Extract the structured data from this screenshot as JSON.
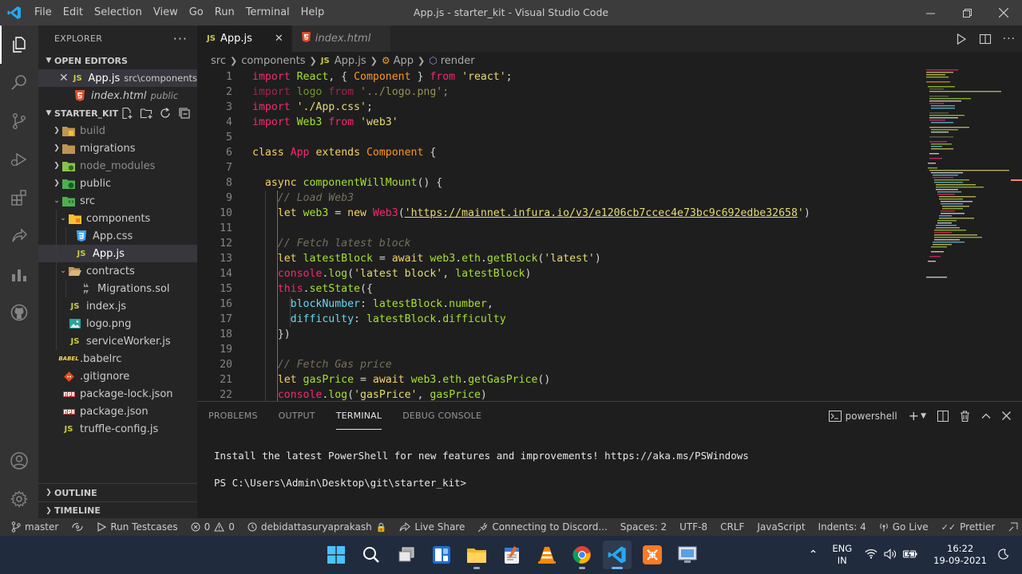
{
  "window": {
    "title": "App.js - starter_kit - Visual Studio Code",
    "menu": [
      "File",
      "Edit",
      "Selection",
      "View",
      "Go",
      "Run",
      "Terminal",
      "Help"
    ]
  },
  "sidebar": {
    "header": "EXPLORER",
    "open_editors": {
      "title": "OPEN EDITORS",
      "items": [
        {
          "icon": "JS",
          "name": "App.js",
          "desc": "src\\components"
        },
        {
          "icon": "html",
          "name": "index.html",
          "desc": "public"
        }
      ]
    },
    "project": {
      "title": "STARTER_KIT",
      "tree": [
        {
          "name": "build",
          "type": "folder",
          "depth": 0,
          "collapsed": true
        },
        {
          "name": "migrations",
          "type": "folder",
          "depth": 0,
          "collapsed": true
        },
        {
          "name": "node_modules",
          "type": "folder",
          "depth": 0,
          "collapsed": true
        },
        {
          "name": "public",
          "type": "folder",
          "depth": 0,
          "collapsed": true
        },
        {
          "name": "src",
          "type": "folder",
          "depth": 0,
          "collapsed": false
        },
        {
          "name": "components",
          "type": "folder",
          "depth": 1,
          "collapsed": false
        },
        {
          "name": "App.css",
          "type": "css",
          "depth": 2
        },
        {
          "name": "App.js",
          "type": "js",
          "depth": 2
        },
        {
          "name": "contracts",
          "type": "folder",
          "depth": 1,
          "collapsed": false
        },
        {
          "name": "Migrations.sol",
          "type": "sol",
          "depth": 2
        },
        {
          "name": "index.js",
          "type": "js",
          "depth": 1
        },
        {
          "name": "logo.png",
          "type": "png",
          "depth": 1
        },
        {
          "name": "serviceWorker.js",
          "type": "js",
          "depth": 1
        },
        {
          "name": ".babelrc",
          "type": "babel",
          "depth": 0
        },
        {
          "name": ".gitignore",
          "type": "git",
          "depth": 0
        },
        {
          "name": "package-lock.json",
          "type": "npm",
          "depth": 0
        },
        {
          "name": "package.json",
          "type": "npm",
          "depth": 0
        },
        {
          "name": "truffle-config.js",
          "type": "js",
          "depth": 0
        }
      ]
    },
    "outline": "OUTLINE",
    "timeline": "TIMELINE"
  },
  "tabs": [
    {
      "icon": "JS",
      "label": "App.js",
      "active": true
    },
    {
      "icon": "html",
      "label": "index.html",
      "active": false
    }
  ],
  "breadcrumb": [
    "src",
    "components",
    "App.js",
    "App",
    "render"
  ],
  "editor": {
    "line_numbers": [
      "1",
      "2",
      "3",
      "4",
      "5",
      "6",
      "7",
      "8",
      "9",
      "10",
      "11",
      "12",
      "13",
      "14",
      "15",
      "16",
      "17",
      "18",
      "19",
      "20",
      "21",
      "22"
    ]
  },
  "panel": {
    "tabs": [
      "PROBLEMS",
      "OUTPUT",
      "TERMINAL",
      "DEBUG CONSOLE"
    ],
    "active_tab": "TERMINAL",
    "shell": "powershell",
    "terminal_lines": [
      "Install the latest PowerShell for new features and improvements! https://aka.ms/PSWindows",
      "PS C:\\Users\\Admin\\Desktop\\git\\starter_kit>"
    ]
  },
  "statusbar": {
    "branch": "master",
    "run_testcases": "Run Testcases",
    "errors": "0",
    "warnings": "0",
    "account": "debidattasuryaprakash",
    "live_share": "Live Share",
    "discord": "Connecting to Discord...",
    "spaces": "Spaces: 2",
    "encoding": "UTF-8",
    "eol": "CRLF",
    "language": "JavaScript",
    "indents": "Indents: 4",
    "go_live": "Go Live",
    "prettier": "Prettier"
  },
  "taskbar": {
    "lang_top": "ENG",
    "lang_bottom": "IN",
    "time": "16:22",
    "date": "19-09-2021"
  },
  "colors": {
    "accent": "#007acc",
    "activitybar": "#333333",
    "sidebar": "#252526",
    "editor": "#1e1e1e",
    "taskbar": "#202b3d"
  }
}
